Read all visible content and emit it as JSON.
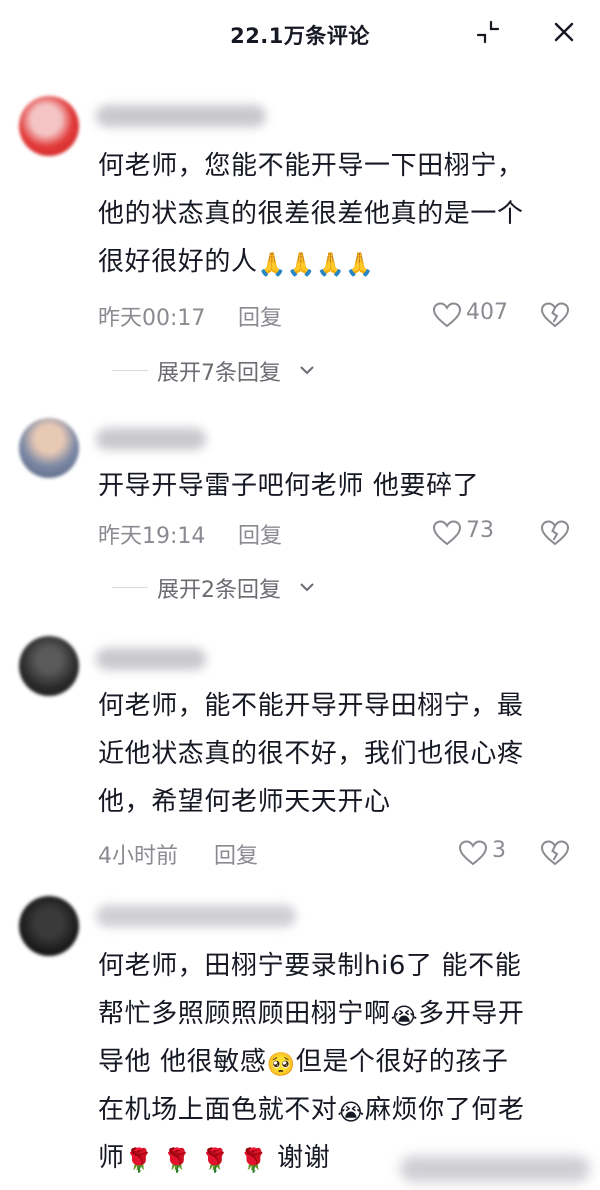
{
  "header": {
    "title": "22.1万条评论",
    "collapse_icon": "collapse-arrows-icon",
    "close_icon": "close-icon"
  },
  "comments": [
    {
      "text_prefix": "何老师，您能不能开导一下田栩宁，\n他的状态真的很差很差他真的是一个\n很好很好的人",
      "emojis": [
        "🙏",
        "🙏",
        "🙏",
        "🙏"
      ],
      "time": "昨天00:17",
      "reply": "回复",
      "likes": "407",
      "expand": "展开7条回复"
    },
    {
      "text": "开导开导雷子吧何老师 他要碎了",
      "time": "昨天19:14",
      "reply": "回复",
      "likes": "73",
      "expand": "展开2条回复"
    },
    {
      "text": "何老师，能不能开导开导田栩宁，最\n近他状态真的很不好，我们也很心疼\n他，希望何老师天天开心",
      "time": "4小时前",
      "reply": "回复",
      "likes": "3"
    },
    {
      "text_a": "何老师，田栩宁要录制hi6了 能不能\n帮忙多照顾照顾田栩宁啊",
      "emoji_cry": "😭",
      "text_b": "多开导开\n导他 他很敏感",
      "emoji_plead": "🥺",
      "text_c": "但是个很好的孩子\n在机场上面色就不对",
      "text_d": "麻烦你了何老\n师",
      "roses": [
        "🌹",
        "🌹",
        "🌹",
        "🌹"
      ],
      "text_e": "谢谢"
    }
  ],
  "colors": {
    "text": "#161823",
    "meta": "#8a8b91",
    "accent": "#fe2c55"
  }
}
